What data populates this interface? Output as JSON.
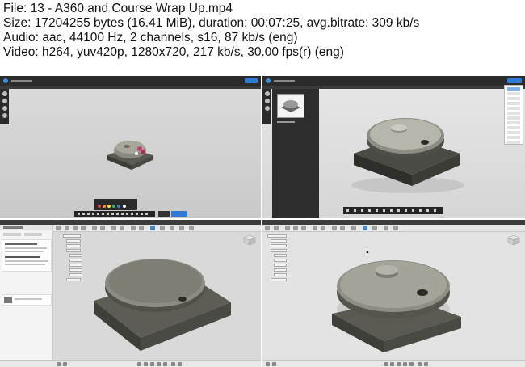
{
  "video_info": {
    "file_line": "File: 13 - A360 and Course Wrap Up.mp4",
    "size_line": "Size: 17204255 bytes (16.41 MiB), duration: 00:07:25, avg.bitrate: 309 kb/s",
    "audio_line": "Audio: aac, 44100 Hz, 2 channels, s16, 87 kb/s (eng)",
    "video_line": "Video: h264, yuv420p, 1280x720, 217 kb/s, 30.00 fps(r) (eng)"
  },
  "colors": {
    "a360_bar": "#2b2b2b",
    "accent_blue": "#2f7bd3",
    "part_gray": "#7d7d73",
    "part_dark": "#4f4f48",
    "fusion_toolbar": "#e8e8e8"
  },
  "frames": [
    {
      "id": "a360-viewer-markup",
      "app": "A360 viewer"
    },
    {
      "id": "a360-viewer-browser",
      "app": "A360 viewer"
    },
    {
      "id": "fusion-data-panel",
      "app": "Fusion 360"
    },
    {
      "id": "fusion-browser-tree",
      "app": "Fusion 360"
    }
  ]
}
